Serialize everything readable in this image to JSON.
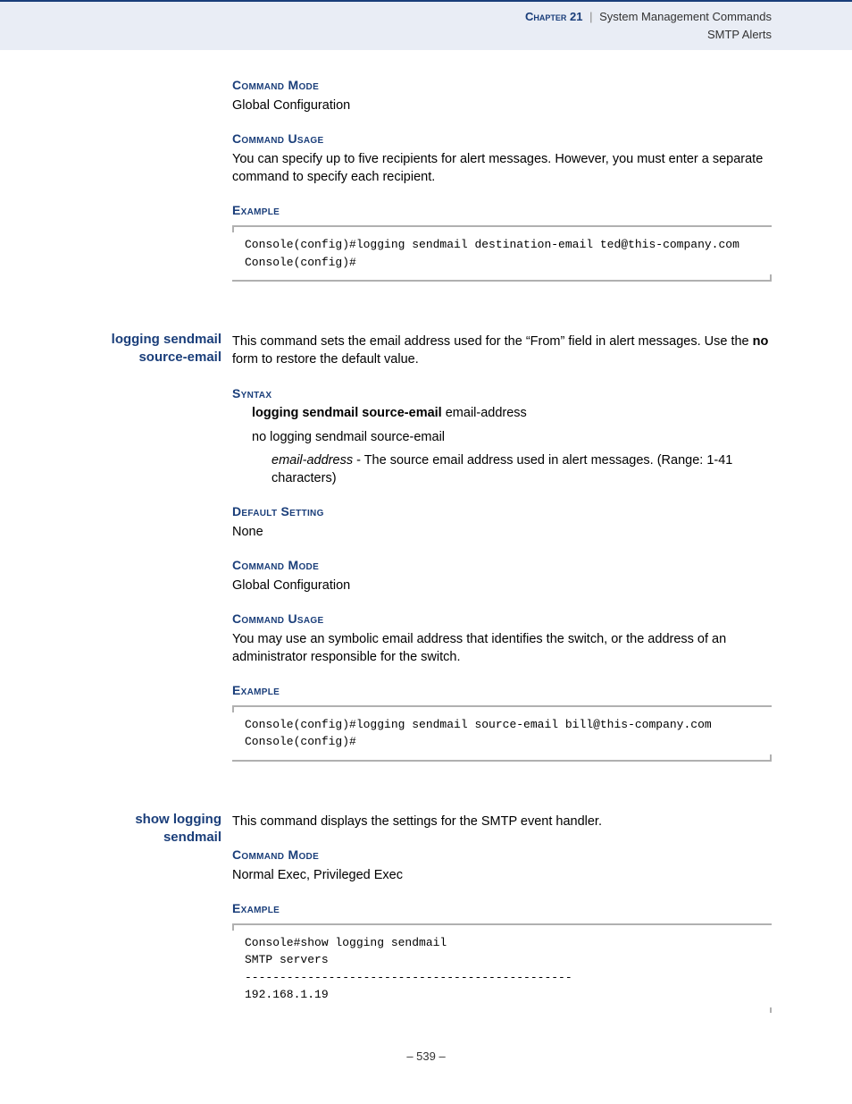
{
  "header": {
    "chapter_label": "Chapter 21",
    "pipe": "|",
    "chapter_title": "System Management Commands",
    "subsection": "SMTP Alerts"
  },
  "sec1": {
    "h_mode": "Command Mode",
    "mode": "Global Configuration",
    "h_usage": "Command Usage",
    "usage": "You can specify up to five recipients for alert messages. However, you must enter a separate command to specify each recipient.",
    "h_example": "Example",
    "example": "Console(config)#logging sendmail destination-email ted@this-company.com\nConsole(config)#"
  },
  "sec2": {
    "cmd_name": "logging sendmail source-email",
    "intro_a": "This command sets the email address used for the “From” field in alert messages. Use the ",
    "intro_bold": "no",
    "intro_b": " form to restore the default value.",
    "h_syntax": "Syntax",
    "syntax_bold": "logging sendmail source-email",
    "syntax_rest": " email-address",
    "syntax_no": "no logging sendmail source-email",
    "param_ital": "email-address",
    "param_rest": " - The source email address used in alert messages. (Range: 1-41 characters)",
    "h_default": "Default Setting",
    "default": "None",
    "h_mode": "Command Mode",
    "mode": "Global Configuration",
    "h_usage": "Command Usage",
    "usage": "You may use an symbolic email address that identifies the switch, or the address of an administrator responsible for the switch.",
    "h_example": "Example",
    "example": "Console(config)#logging sendmail source-email bill@this-company.com\nConsole(config)#"
  },
  "sec3": {
    "cmd_name": "show logging sendmail",
    "intro": "This command displays the settings for the SMTP event handler.",
    "h_mode": "Command Mode",
    "mode": "Normal Exec, Privileged Exec",
    "h_example": "Example",
    "example": "Console#show logging sendmail\nSMTP servers\n-----------------------------------------------\n192.168.1.19"
  },
  "page_number": "–  539  –"
}
